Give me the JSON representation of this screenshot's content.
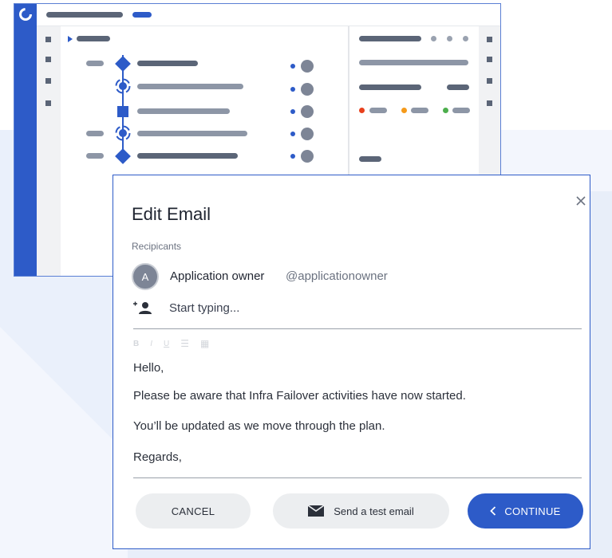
{
  "modal": {
    "title": "Edit Email",
    "recipients_label": "Recipicants",
    "recipient": {
      "avatar_letter": "A",
      "name": "Application owner",
      "handle": "@applicationowner"
    },
    "add_recipient_placeholder": "Start typing...",
    "toolbar": {
      "bold": "B",
      "italic": "I",
      "underline": "U",
      "list": "☰",
      "table": "▦"
    },
    "body": {
      "greeting": "Hello,",
      "line1": "Please be aware that Infra Failover activities have now started.",
      "line2": "You’ll be updated as we move through the plan.",
      "signoff": "Regards,"
    },
    "buttons": {
      "cancel": "CANCEL",
      "test": "Send a test email",
      "continue": "CONTINUE"
    }
  },
  "icons": {
    "close": "close-icon",
    "add_user": "add-user-icon",
    "mail": "mail-icon",
    "chevron_left": "chevron-left-icon"
  },
  "colors": {
    "accent": "#2d5bc8",
    "status_red": "#e8401c",
    "status_orange": "#f59a1a",
    "status_green": "#4cae4c"
  }
}
